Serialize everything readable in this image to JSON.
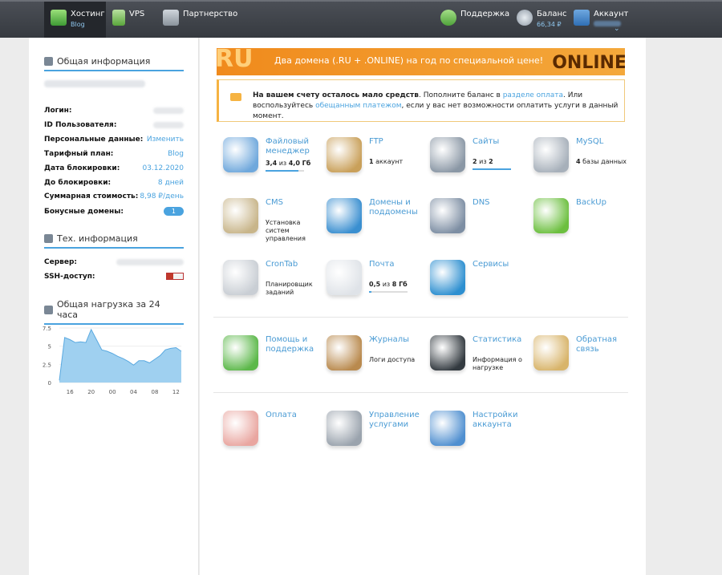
{
  "topbar": {
    "hosting": {
      "label": "Хостинг",
      "sub": "Blog"
    },
    "vps": {
      "label": "VPS"
    },
    "partner": {
      "label": "Партнерство"
    },
    "support": {
      "label": "Поддержка"
    },
    "balance": {
      "label": "Баланс",
      "value": "66,34 ₽"
    },
    "account": {
      "label": "Аккаунт",
      "chevron": "⌄"
    }
  },
  "sidebar": {
    "general": {
      "title": "Общая информация",
      "rows": [
        {
          "key": "Логин:",
          "value": ""
        },
        {
          "key": "ID Пользователя:",
          "value": ""
        },
        {
          "key": "Персональные данные:",
          "value": "Изменить"
        },
        {
          "key": "Тарифный план:",
          "value": "Blog"
        },
        {
          "key": "Дата блокировки:",
          "value": "03.12.2020"
        },
        {
          "key": "До блокировки:",
          "value": "8 дней"
        },
        {
          "key": "Суммарная стоимость:",
          "value": "8,98 ₽/день"
        },
        {
          "key": "Бонусные домены:",
          "value": "1"
        }
      ]
    },
    "tech": {
      "title": "Тех. информация",
      "rows": [
        {
          "key": "Сервер:",
          "value": ""
        },
        {
          "key": "SSH-доступ:",
          "value": ""
        }
      ]
    },
    "load": {
      "title": "Общая нагрузка за 24 часа"
    }
  },
  "chart_data": {
    "type": "area",
    "x": [
      "14",
      "15",
      "16",
      "17",
      "18",
      "19",
      "20",
      "21",
      "22",
      "23",
      "00",
      "01",
      "02",
      "03",
      "04",
      "05",
      "06",
      "07",
      "08",
      "09",
      "10",
      "11",
      "12",
      "13"
    ],
    "values": [
      0.3,
      6.2,
      5.9,
      5.5,
      5.6,
      5.5,
      7.3,
      5.9,
      4.5,
      4.3,
      4.0,
      3.6,
      3.3,
      2.9,
      2.4,
      3.0,
      3.0,
      2.7,
      3.2,
      3.7,
      4.5,
      4.7,
      4.8,
      4.3
    ],
    "xticks": [
      "16",
      "20",
      "00",
      "04",
      "08",
      "12"
    ],
    "yticks": [
      "7.5",
      "5",
      "2.5",
      "0"
    ],
    "ylim": [
      0,
      7.5
    ],
    "color": "#9fd0f0",
    "line_color": "#5aa9e0"
  },
  "banner": {
    "left": "RU",
    "text": "Два домена (.RU + .ONLINE) на год по специальной цене!",
    "right": "ONLINE"
  },
  "notice": {
    "bold": "На вашем счету осталось мало средств",
    "t1": ". Пополните баланс в ",
    "link1": "разделе оплата",
    "t2": ". Или воспользуйтесь ",
    "link2": "обещанным платежом",
    "t3": ", если у вас нет возможности оплатить услуги в данный момент."
  },
  "tiles": [
    {
      "name": "Файловый менеджер",
      "desc_b": "3,4",
      "desc_m": " из ",
      "desc_e": "4,0 Гб",
      "bar": 0.85,
      "icon": "file-manager-icon",
      "color": "#6fa8dc"
    },
    {
      "name": "FTP",
      "desc_b": "1",
      "desc_m": " аккаунт",
      "desc_e": "",
      "icon": "ftp-icon",
      "color": "#c9a05a"
    },
    {
      "name": "Сайты",
      "desc_b": "2",
      "desc_m": " из ",
      "desc_e": "2",
      "bar": 1.0,
      "icon": "sites-icon",
      "color": "#8a97a5"
    },
    {
      "name": "MySQL",
      "desc_b": "4",
      "desc_m": " базы данных",
      "desc_e": "",
      "icon": "mysql-icon",
      "color": "#a7b0ba"
    },
    {
      "name": "CMS",
      "desc": "Установка систем управления",
      "icon": "cms-icon",
      "color": "#c8b58a"
    },
    {
      "name": "Домены и поддомены",
      "icon": "domains-icon",
      "color": "#3a8fd0"
    },
    {
      "name": "DNS",
      "icon": "dns-icon",
      "color": "#7d8ea3"
    },
    {
      "name": "BackUp",
      "icon": "backup-icon",
      "color": "#6cbf3f"
    },
    {
      "name": "CronTab",
      "desc": "Планировщик заданий",
      "icon": "crontab-icon",
      "color": "#c9ced4"
    },
    {
      "name": "Почта",
      "desc_b": "0,5",
      "desc_m": " из ",
      "desc_e": "8 Гб",
      "bar": 0.06,
      "icon": "mail-icon",
      "color": "#dfe3e8"
    },
    {
      "name": "Сервисы",
      "icon": "services-icon",
      "color": "#2d8fd0"
    },
    {
      "name": "Помощь и поддержка",
      "icon": "help-icon",
      "color": "#5cb84a"
    },
    {
      "name": "Журналы",
      "desc": "Логи доступа",
      "icon": "logs-icon",
      "color": "#b98a4e"
    },
    {
      "name": "Статистика",
      "desc": "Информация о нагрузке",
      "icon": "statistics-icon",
      "color": "#333a40"
    },
    {
      "name": "Обратная связь",
      "icon": "feedback-icon",
      "color": "#d8b46a"
    },
    {
      "name": "Оплата",
      "icon": "payment-icon",
      "color": "#e9a6a0"
    },
    {
      "name": "Управление услугами",
      "icon": "services-manage-icon",
      "color": "#9aa3ad"
    },
    {
      "name": "Настройки аккаунта",
      "icon": "account-settings-icon",
      "color": "#4f8fd0"
    }
  ]
}
